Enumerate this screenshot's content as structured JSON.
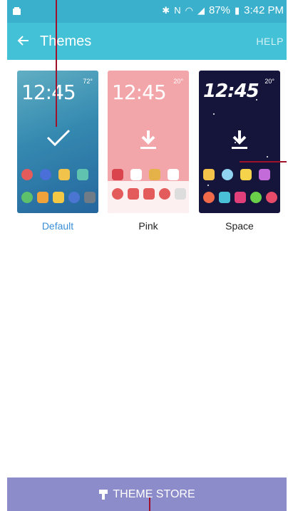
{
  "status": {
    "battery": "87%",
    "time": "3:42 PM"
  },
  "header": {
    "title": "Themes",
    "help": "HELP"
  },
  "themes": [
    {
      "label": "Default",
      "clock": "12:45",
      "weather": "72°"
    },
    {
      "label": "Pink",
      "clock": "12:45",
      "weather": "20°"
    },
    {
      "label": "Space",
      "clock": "12:45",
      "weather": "20°"
    }
  ],
  "footer": {
    "store": "THEME STORE"
  },
  "colors": {
    "accent": "#43c1d6",
    "status": "#3ab0cc",
    "store": "#8c8ccb",
    "selected_text": "#3a8fd8"
  },
  "icons": [
    "back-arrow-icon",
    "check-icon",
    "download-icon",
    "brush-icon",
    "wifi-icon",
    "bluetooth-icon",
    "battery-icon"
  ]
}
